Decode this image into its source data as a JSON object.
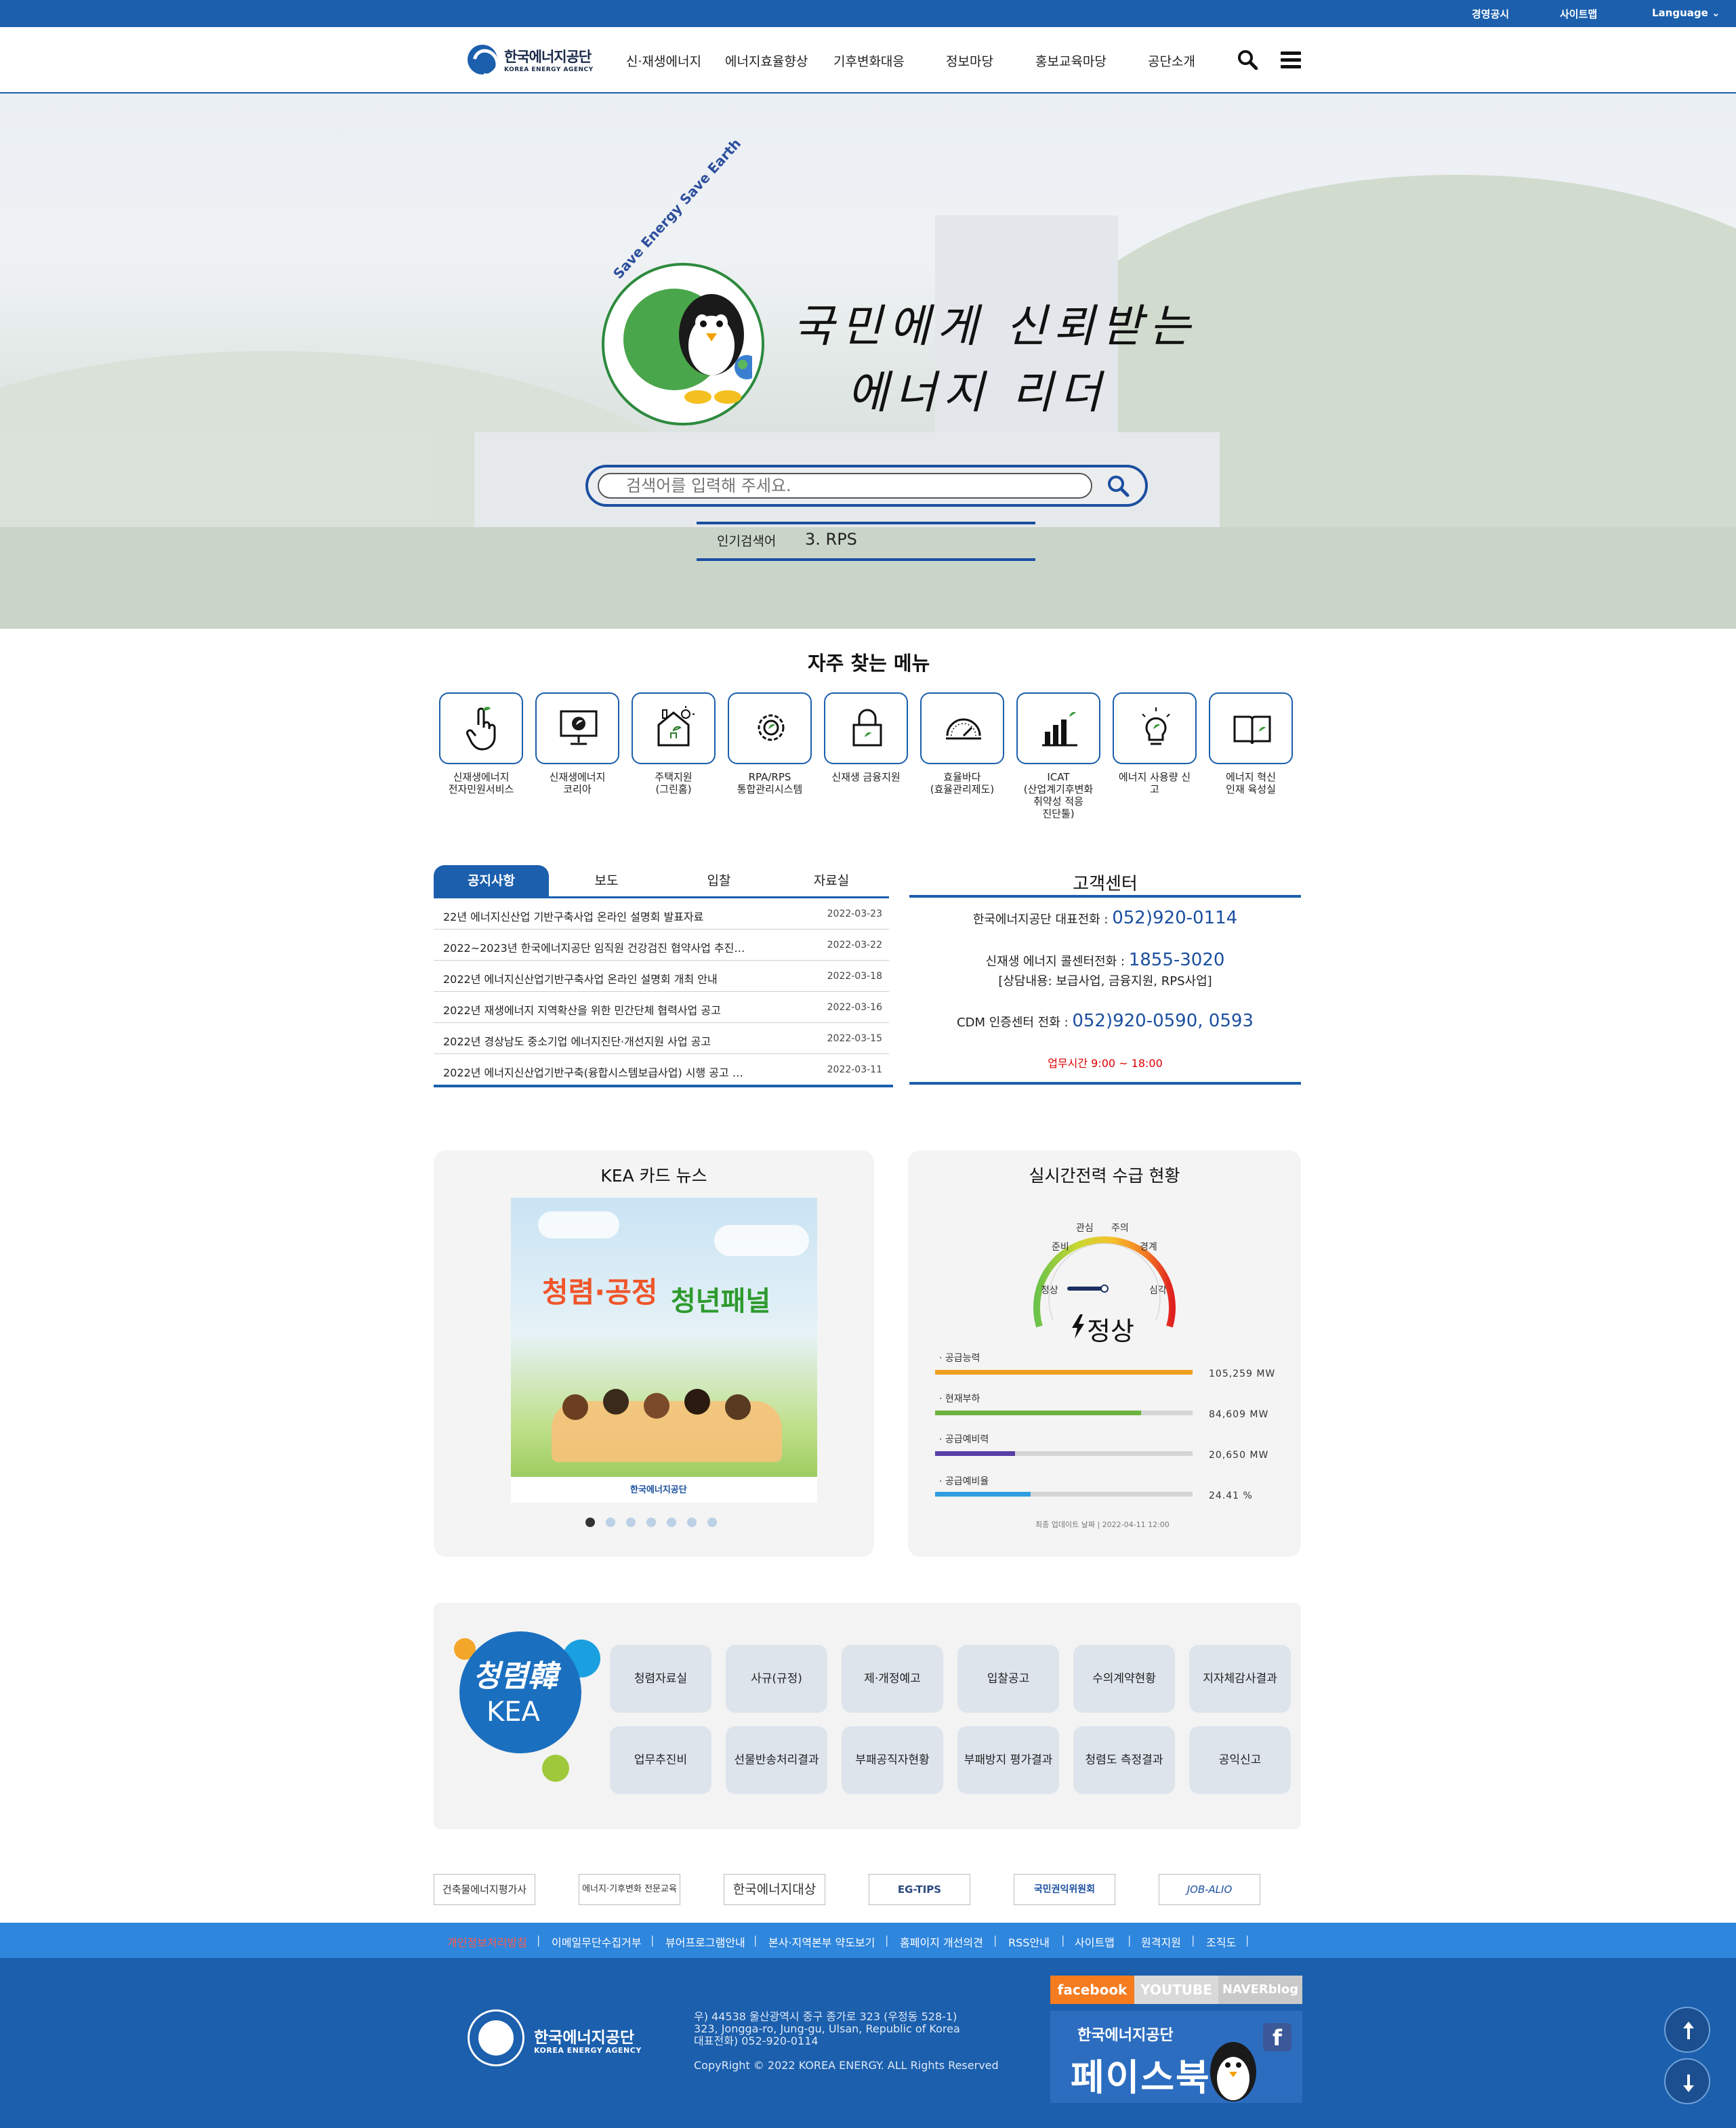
{
  "topbar": {
    "links": [
      "경영공시",
      "사이트맵",
      "Language ⌄"
    ]
  },
  "header": {
    "logo_ko": "한국에너지공단",
    "logo_en": "KOREA ENERGY AGENCY",
    "nav": [
      "신·재생에너지",
      "에너지효율향상",
      "기후변화대응",
      "정보마당",
      "홍보교육마당",
      "공단소개"
    ]
  },
  "hero": {
    "ring_text": "Save Energy Save Earth",
    "slogan_line1": "국민에게 신뢰받는",
    "slogan_line2": "에너지 리더",
    "search_placeholder": "검색어를 입력해 주세요.",
    "popular_label": "인기검색어",
    "popular_value": "3. RPS"
  },
  "quick_menu": {
    "title": "자주 찾는 메뉴",
    "items": [
      {
        "label": "신재생에너지\n전자민원서비스",
        "icon": "hand-pointer-icon"
      },
      {
        "label": "신재생에너지\n코리아",
        "icon": "monitor-leaf-icon"
      },
      {
        "label": "주택지원\n(그린홈)",
        "icon": "house-sun-icon"
      },
      {
        "label": "RPA/RPS\n통합관리시스템",
        "icon": "gear-leaf-icon"
      },
      {
        "label": "신재생 금융지원",
        "icon": "lock-leaf-icon"
      },
      {
        "label": "효율바다\n(효율관리제도)",
        "icon": "gauge-icon"
      },
      {
        "label": "ICAT\n(산업계기후변화\n취약성 적응\n진단툴)",
        "icon": "bar-chart-leaf-icon"
      },
      {
        "label": "에너지 사용량 신\n고",
        "icon": "lightbulb-icon"
      },
      {
        "label": "에너지 혁신\n인재 육성실",
        "icon": "book-leaf-icon"
      }
    ]
  },
  "notices": {
    "tabs": [
      "공지사항",
      "보도",
      "입찰",
      "자료실"
    ],
    "rows": [
      {
        "title": "22년 에너지신산업 기반구축사업 온라인 설명회 발표자료",
        "date": "2022-03-23"
      },
      {
        "title": "2022~2023년 한국에너지공단 임직원 건강검진 협약사업 추진…",
        "date": "2022-03-22"
      },
      {
        "title": "2022년 에너지신산업기반구축사업 온라인 설명회 개최 안내",
        "date": "2022-03-18"
      },
      {
        "title": "2022년 재생에너지 지역확산을 위한 민간단체 협력사업 공고",
        "date": "2022-03-16"
      },
      {
        "title": "2022년 경상남도 중소기업 에너지진단·개선지원 사업 공고",
        "date": "2022-03-15"
      },
      {
        "title": "2022년 에너지신산업기반구축(융합시스템보급사업) 시행 공고 …",
        "date": "2022-03-11"
      }
    ]
  },
  "customer_center": {
    "title": "고객센터",
    "rep_label": "한국에너지공단 대표전화 :",
    "rep_num": "052)920-0114",
    "call_label": "신재생 에너지 콜센터전화 :",
    "call_num": "1855-3020",
    "call_sub": "[상담내용: 보급사업, 금융지원, RPS사업]",
    "cdm_label": "CDM 인증센터 전화 :",
    "cdm_num": "052)920-0590, 0593",
    "hours": "업무시간 9:00 ~ 18:00"
  },
  "card_news": {
    "title": "KEA 카드 뉴스",
    "headline_a": "청렴·공정",
    "headline_b": "청년패널",
    "footer_logo": "한국에너지공단",
    "dots": 7,
    "active_dot": 0
  },
  "power": {
    "title": "실시간전력 수급 현황",
    "gauge_labels": [
      "관심",
      "주의",
      "준비",
      "경계",
      "정상",
      "심각"
    ],
    "state": "정상",
    "bars": [
      {
        "label": "· 공급능력",
        "value": "105,259 MW",
        "fill": 1.0,
        "color": "#f0a020"
      },
      {
        "label": "· 현재부하",
        "value": "84,609 MW",
        "fill": 0.8,
        "color": "#6db33f"
      },
      {
        "label": "· 공급예비력",
        "value": "20,650 MW",
        "fill": 0.31,
        "color": "#5b3ea6"
      },
      {
        "label": "· 공급예비율",
        "value": "24.41 %",
        "fill": 0.37,
        "color": "#2e9ee0"
      }
    ],
    "updated": "최종 업데이트 날짜 | 2022-04-11 12:00"
  },
  "integrity": {
    "logo_line1": "청렴韓",
    "logo_line2": "KEA",
    "buttons": [
      "청렴자료실",
      "사규(규정)",
      "제·개정예고",
      "입찰공고",
      "수의계약현황",
      "지자체감사결과",
      "업무추진비",
      "선물반송처리결과",
      "부패공직자현황",
      "부패방지 평가결과",
      "청렴도 측정결과",
      "공익신고"
    ]
  },
  "banners": [
    "건축물에너지평가사",
    "에너지·기후변화 전문교육",
    "한국에너지대상",
    "EG-TIPS",
    "국민권익위원회",
    "JOB-ALIO"
  ],
  "footer_links": {
    "items": [
      "개인정보처리방침",
      "이메일무단수집거부",
      "뷰어프로그램안내",
      "본사·지역본부 약도보기",
      "홈페이지 개선의견",
      "RSS안내",
      "사이트맵",
      "원격지원",
      "조직도"
    ]
  },
  "footer": {
    "logo_ko": "한국에너지공단",
    "logo_en": "KOREA ENERGY AGENCY",
    "addr1": "우) 44538 울산광역시 중구 종가로 323 (우정동 528-1)",
    "addr2": "323, Jongga-ro, Jung-gu, Ulsan, Republic of Korea",
    "addr3": "대표전화) 052-920-0114",
    "copyright": "CopyRight © 2022 KOREA ENERGY. ALL Rights Reserved",
    "sns_tabs": [
      "facebook",
      "YOUTUBE",
      "NAVERblog"
    ],
    "fb_banner_line1": "한국에너지공단",
    "fb_banner_line2": "페이스북"
  },
  "colors": {
    "brand_blue": "#1b5fad",
    "link_bar": "#2f86dd",
    "accent_red": "#dd0000"
  }
}
